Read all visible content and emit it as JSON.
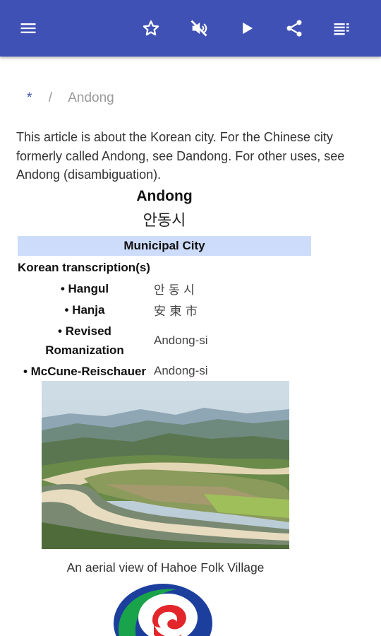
{
  "toolbar": {
    "icons": [
      "menu-icon",
      "star-icon",
      "volume-off-icon",
      "play-icon",
      "share-icon",
      "list-icon"
    ]
  },
  "breadcrumb": {
    "home": "*",
    "separator": "/",
    "current": "Andong"
  },
  "intro": "This article is about the Korean city. For the Chinese city formerly called Andong, see Dandong. For other uses, see Andong (disambiguation).",
  "infobox": {
    "title": "Andong",
    "native_name": "안동시",
    "type": "Municipal City",
    "section": "Korean transcription(s)",
    "rows": [
      {
        "label": "• Hangul",
        "value": "안 동 시"
      },
      {
        "label": "• Hanja",
        "value": "安 東 市"
      },
      {
        "label": "• Revised Romanization",
        "value": "Andong-si"
      },
      {
        "label": "• McCune-Reischauer",
        "value": "Andong-si"
      }
    ]
  },
  "image": {
    "caption": "An aerial view of Hahoe Folk Village"
  },
  "colors": {
    "appbar": "#3f51b5",
    "infobox_header": "#cddcfb"
  }
}
